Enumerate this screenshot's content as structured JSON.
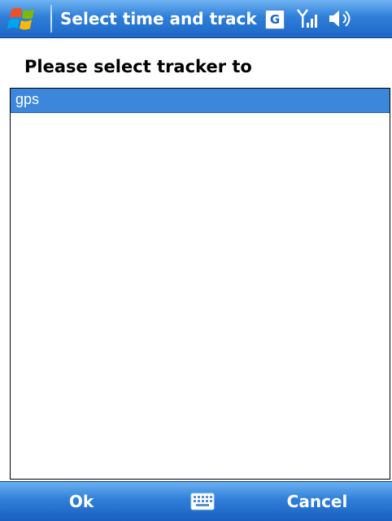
{
  "titlebar": {
    "title": "Select time and track",
    "start_icon": "windows-flag-icon",
    "indicator_letter": "G",
    "signal_icon": "signal-strength-icon",
    "volume_icon": "volume-icon",
    "colors": {
      "bar": "#2f7fd9",
      "text": "#ffffff"
    }
  },
  "main": {
    "prompt": "Please select tracker to",
    "tracker_list": {
      "items": [
        "gps"
      ],
      "selected_index": 0,
      "selected_color": "#3c86dc"
    }
  },
  "softkeys": {
    "left_label": "Ok",
    "right_label": "Cancel",
    "center_icon": "keyboard-icon"
  }
}
